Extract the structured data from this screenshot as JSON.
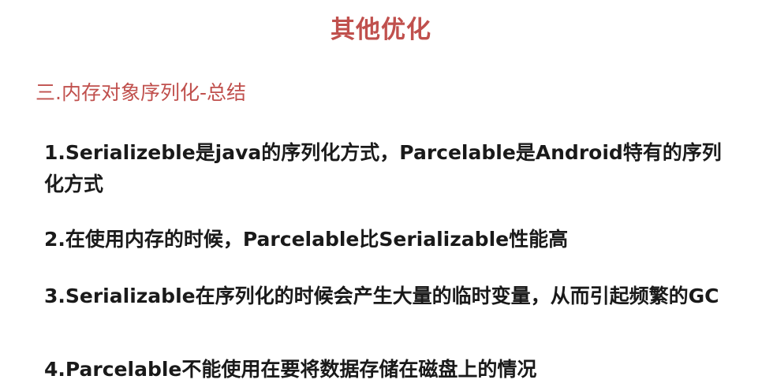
{
  "slide": {
    "title": "其他优化",
    "subtitle": "三.内存对象序列化-总结",
    "points": [
      "1.Serializeble是java的序列化方式，Parcelable是Android特有的序列化方式",
      "2.在使用内存的时候，Parcelable比Serializable性能高",
      "3.Serializable在序列化的时候会产生大量的临时变量，从而引起频繁的GC",
      "4.Parcelable不能使用在要将数据存储在磁盘上的情况"
    ]
  },
  "colors": {
    "accent": "#c0504d",
    "text": "#1a1a1a",
    "background": "#ffffff"
  }
}
